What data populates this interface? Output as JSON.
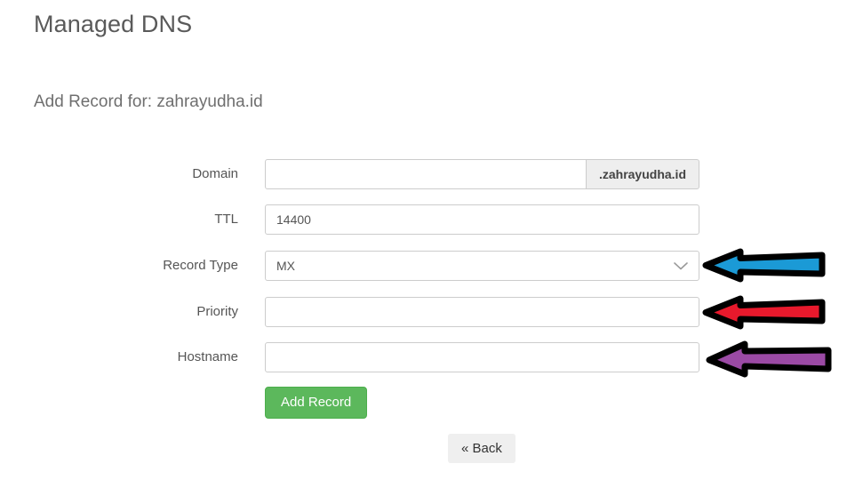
{
  "header": {
    "title": "Managed DNS",
    "subtitle": "Add Record for: zahrayudha.id"
  },
  "form": {
    "fields": [
      {
        "label": "Domain",
        "type": "input-group",
        "value": "",
        "addon": ".zahrayudha.id"
      },
      {
        "label": "TTL",
        "type": "text",
        "value": "14400"
      },
      {
        "label": "Record Type",
        "type": "select",
        "value": "MX",
        "icon": "chevron-down-icon"
      },
      {
        "label": "Priority",
        "type": "text",
        "value": ""
      },
      {
        "label": "Hostname",
        "type": "text",
        "value": ""
      }
    ],
    "submit_label": "Add Record",
    "back_label": "« Back"
  },
  "annotations": {
    "arrows": [
      {
        "name": "arrow-record-type",
        "color": "#1b9ad6",
        "outline": "#000000",
        "points_to": "Record Type",
        "direction": "left"
      },
      {
        "name": "arrow-priority",
        "color": "#e8192c",
        "outline": "#000000",
        "points_to": "Priority",
        "direction": "left"
      },
      {
        "name": "arrow-hostname",
        "color": "#9b4aa5",
        "outline": "#000000",
        "points_to": "Hostname",
        "direction": "left"
      }
    ]
  },
  "colors": {
    "submit_green": "#5cb85c",
    "addon_gray": "#eeeeee",
    "border_gray": "#cccccc",
    "text_gray": "#555555"
  }
}
